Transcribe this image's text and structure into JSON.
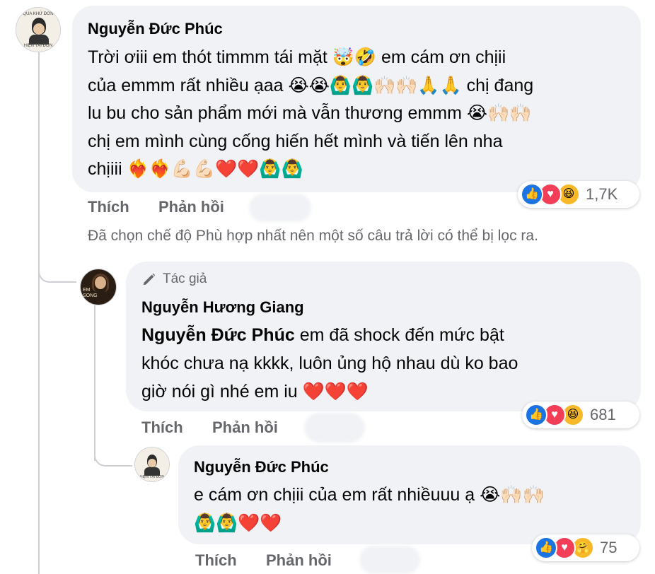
{
  "comments": [
    {
      "author": "Nguyễn Đức Phúc",
      "avatar_text": [
        "QUA KHỨ ĐƠN",
        "HIỆN TẠI ĐƠN"
      ],
      "lines": [
        {
          "text": "Trời ơiii em thót timmm tái mặt ",
          "emoji": "🤯🤣",
          "after": " em cám ơn chịii"
        },
        {
          "text": "của emmm rất nhiều ạaa ",
          "emoji": "😭😭🙆‍♂️🙆‍♂️🙌🏻🙌🏻🙏🙏",
          "after": " chị đang"
        },
        {
          "text": "lu bu cho sản phẩm mới mà vẫn thương emmm ",
          "emoji": "😭🙌🏻🙌🏻",
          "after": ""
        },
        {
          "text": "chị em mình cùng cống hiến hết mình và tiến lên nha",
          "emoji": "",
          "after": ""
        },
        {
          "text": "chịiii ",
          "emoji": "❤️‍🔥❤️‍🔥💪🏻💪🏻❤️❤️🙆‍♂️🙆‍♂️",
          "after": ""
        }
      ],
      "actions": {
        "like": "Thích",
        "reply": "Phản hồi"
      },
      "reactions": {
        "count": "1,7K",
        "icons": [
          "like",
          "love",
          "haha"
        ]
      }
    },
    {
      "badge": "Tác giả",
      "author": "Nguyễn Hương Giang",
      "avatar_text": [
        "EM",
        "SONG"
      ],
      "mention": "Nguyễn Đức Phúc",
      "lines": [
        {
          "text": " em đã shock đến mức bật"
        },
        {
          "text": "khóc chưa nạ kkkk, luôn ủng hộ nhau dù ko bao"
        },
        {
          "text": "giờ nói gì nhé em iu ",
          "emoji": "❤️❤️❤️"
        }
      ],
      "actions": {
        "like": "Thích",
        "reply": "Phản hồi"
      },
      "reactions": {
        "count": "681",
        "icons": [
          "like",
          "love",
          "haha"
        ]
      }
    },
    {
      "author": "Nguyễn Đức Phúc",
      "avatar_text": [
        "QUA KHỨ ĐƠN",
        "HIỆN TẠI ĐƠN"
      ],
      "lines": [
        {
          "text": "e cám ơn chịii của em rất nhiềuuu ạ ",
          "emoji": "😭🙌🏻🙌🏻"
        },
        {
          "text": "",
          "emoji": "🙆‍♂️🙆‍♂️❤️❤️"
        }
      ],
      "actions": {
        "like": "Thích",
        "reply": "Phản hồi"
      },
      "reactions": {
        "count": "75",
        "icons": [
          "like",
          "love",
          "care"
        ]
      }
    }
  ],
  "filter_notice": "Đã chọn chế độ Phù hợp nhất nên một số câu trả lời có thể bị lọc ra.",
  "icons": {
    "like": "thumbs-up-icon",
    "love": "heart-icon",
    "haha": "laughing-face-icon",
    "care": "hugging-face-icon",
    "badge": "pen-icon"
  }
}
